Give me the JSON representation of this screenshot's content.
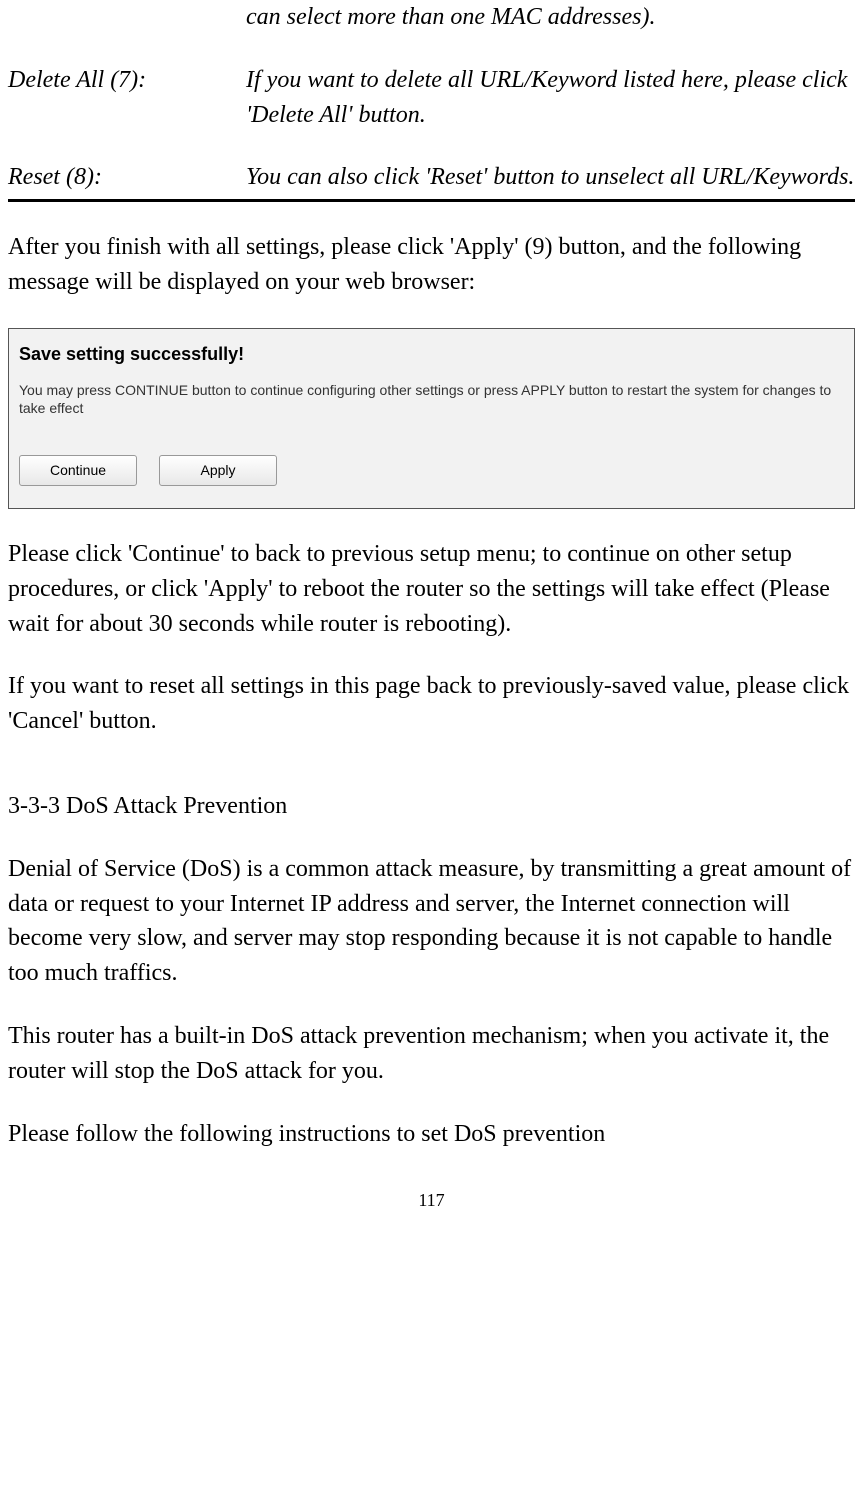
{
  "definitions": {
    "row0_desc": "can select more than one MAC addresses).",
    "delete_all_label": "Delete All (7):",
    "delete_all_desc": "If you want to delete all URL/Keyword listed here, please click 'Delete All' button.",
    "reset_label": "Reset (8):",
    "reset_desc": "You can also click 'Reset' button to unselect all URL/Keywords."
  },
  "para1": "After you finish with all settings, please click 'Apply' (9) button, and the following message will be displayed on your web browser:",
  "dialog": {
    "title": "Save setting successfully!",
    "text": "You may press CONTINUE button to continue configuring other settings or press APPLY button to restart the system for changes to take effect",
    "continue_label": "Continue",
    "apply_label": "Apply"
  },
  "para2": "Please click 'Continue' to back to previous setup menu; to continue on other setup procedures, or click 'Apply' to reboot the router so the settings will take effect (Please wait for about 30 seconds while router is rebooting).",
  "para3": "If you want to reset all settings in this page back to previously-saved value, please click 'Cancel' button.",
  "section_heading": "3-3-3 DoS Attack Prevention",
  "para4": "Denial of Service (DoS) is a common attack measure, by transmitting a great amount of data or request to your Internet IP address and server, the Internet connection will become very slow, and server may stop responding because it is not capable to handle too much traffics.",
  "para5": "This router has a built-in DoS attack prevention mechanism; when you activate it, the router will stop the DoS attack for you.",
  "para6": "Please follow the following instructions to set DoS prevention",
  "page_number": "117"
}
